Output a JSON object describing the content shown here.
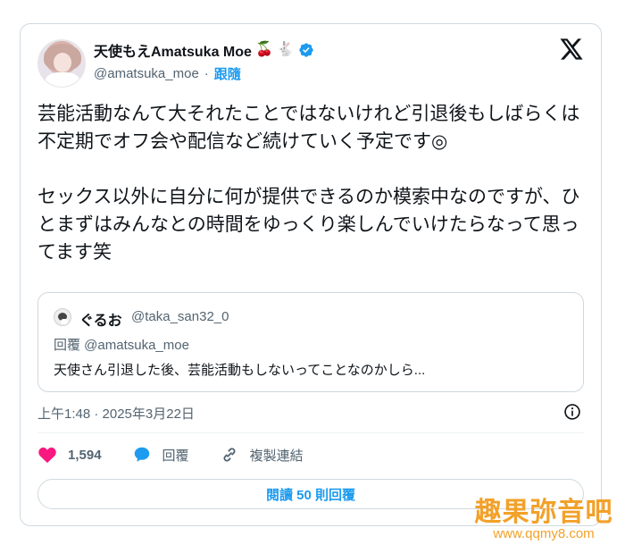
{
  "author": {
    "name": "天使もえAmatsuka Moe",
    "name_emojis": [
      "🍒",
      "🐇"
    ],
    "handle": "@amatsuka_moe",
    "separator": "·",
    "follow_label": "跟隨"
  },
  "tweet": {
    "paragraphs": [
      "芸能活動なんて大それたことではないけれど引退後もしばらくは不定期でオフ会や配信など続けていく予定です◎",
      "セックス以外に自分に何が提供できるのか模索中なのですが、ひとまずはみんなとの時間をゆっくり楽しんでいけたらなって思ってます笑"
    ],
    "timestamp": "上午1:48 · 2025年3月22日"
  },
  "quote": {
    "name": "ぐるお",
    "handle": "@taka_san32_0",
    "reply_to": "回覆 @amatsuka_moe",
    "text": "天使さん引退した後、芸能活動もしないってことなのかしら..."
  },
  "actions": {
    "likes_count": "1,594",
    "reply_label": "回覆",
    "copy_link_label": "複製連結"
  },
  "read_replies_label": "閱讀 50 則回覆",
  "watermark": {
    "title": "趣果弥音吧",
    "url": "www.qqmy8.com"
  },
  "colors": {
    "accent": "#1d9bf0",
    "like": "#f91880",
    "text": "#0f1419",
    "secondary": "#536471",
    "border": "#cfd9de",
    "watermark": "#f2a12a"
  },
  "icons": {
    "verified": "verified-badge-icon",
    "x_logo": "x-logo-icon",
    "info": "info-icon",
    "like": "heart-icon",
    "reply": "speech-bubble-icon",
    "copy_link": "link-icon"
  }
}
